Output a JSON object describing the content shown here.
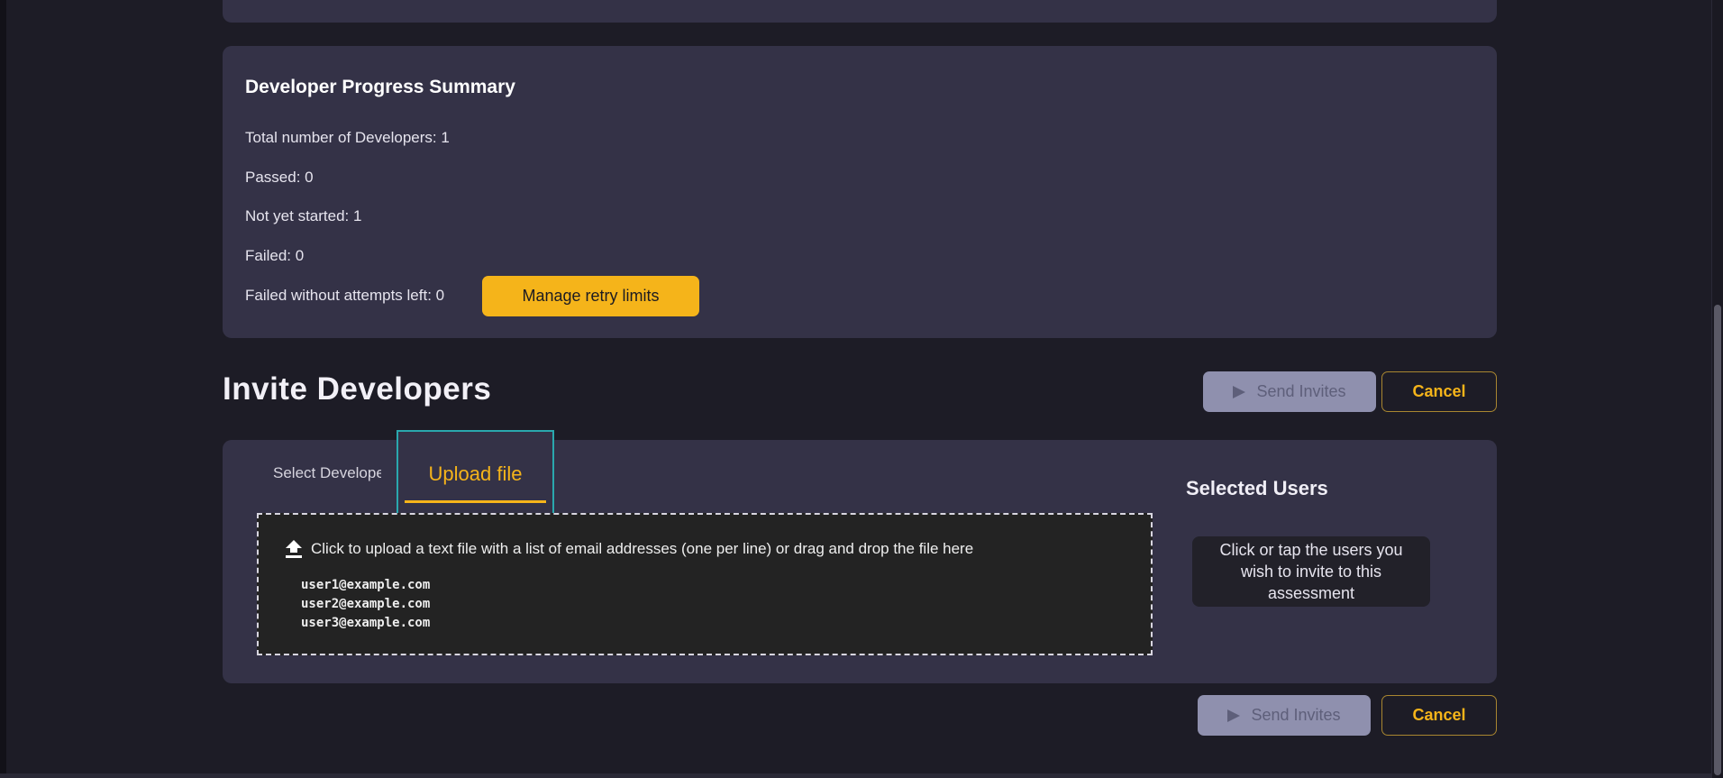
{
  "summary": {
    "title": "Developer Progress Summary",
    "total": "Total number of Developers: 1",
    "passed": "Passed: 0",
    "not_started": "Not yet started: 1",
    "failed": "Failed: 0",
    "failed_no_attempts": "Failed without attempts left: 0",
    "manage_retry_label": "Manage retry limits"
  },
  "invite": {
    "title": "Invite Developers",
    "send_label": "Send Invites",
    "cancel_label": "Cancel",
    "tabs": [
      {
        "label": "Select Developers",
        "active": false
      },
      {
        "label": "Upload file",
        "active": true
      }
    ],
    "upload": {
      "instruction": "Click to upload a text file with a list of email addresses (one per line) or drag and drop the file here",
      "examples": [
        "user1@example.com",
        "user2@example.com",
        "user3@example.com"
      ]
    },
    "selected_users": {
      "title": "Selected Users",
      "hint": "Click or tap the users you wish to invite to this assessment"
    }
  },
  "colors": {
    "accent": "#f5b41a",
    "card_bg": "#343247",
    "page_bg": "#1d1c26",
    "focus_ring": "#2aa8ae",
    "disabled_button": "#8f90ae"
  },
  "icons": {
    "send": "send-icon",
    "upload": "upload-icon"
  }
}
